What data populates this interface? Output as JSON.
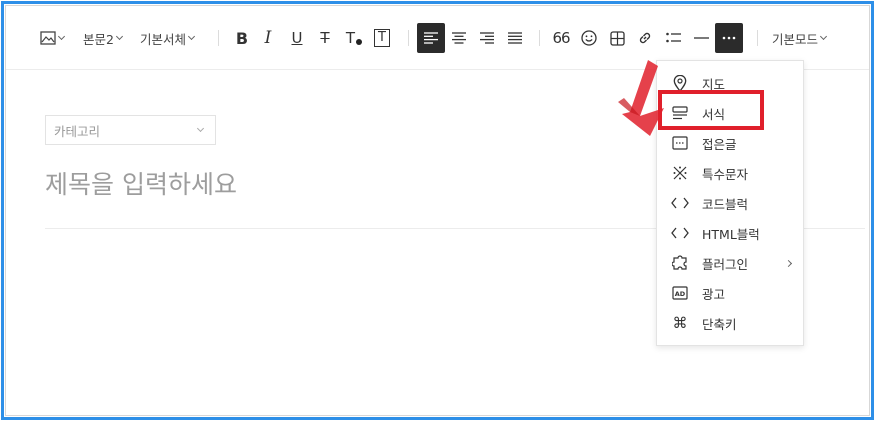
{
  "toolbar": {
    "image_label": "",
    "paragraph_style": "본문2",
    "font_family": "기본서체",
    "mode": "기본모드",
    "quote_label": "66",
    "text_color_label": "T",
    "background_color_label": "T",
    "bold_label": "B",
    "italic_label": "I",
    "underline_label": "U",
    "strike_label": "T"
  },
  "editor": {
    "category_placeholder": "카테고리",
    "title_placeholder": "제목을 입력하세요"
  },
  "more_menu": {
    "items": [
      {
        "label": "지도",
        "icon": "map-pin-icon"
      },
      {
        "label": "서식",
        "icon": "template-icon"
      },
      {
        "label": "접은글",
        "icon": "fold-icon"
      },
      {
        "label": "특수문자",
        "icon": "special-char-icon"
      },
      {
        "label": "코드블럭",
        "icon": "code-icon"
      },
      {
        "label": "HTML블럭",
        "icon": "html-icon"
      },
      {
        "label": "플러그인",
        "icon": "plugin-icon"
      },
      {
        "label": "광고",
        "icon": "ad-icon"
      },
      {
        "label": "단축키",
        "icon": "command-icon"
      }
    ],
    "highlighted_item": "서식"
  },
  "colors": {
    "frame": "#2d8fe8",
    "highlight": "#e0202b",
    "active_button": "#2b2b2b"
  }
}
